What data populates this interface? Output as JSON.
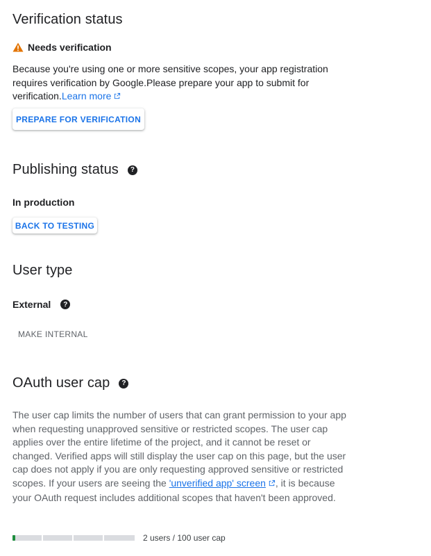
{
  "verification": {
    "title": "Verification status",
    "status": "Needs verification",
    "description": "Because you're using one or more sensitive scopes, your app registration requires verification by Google.Please prepare your app to submit for verification.",
    "learn_more": "Learn more",
    "button": "PREPARE FOR VERIFICATION"
  },
  "publishing": {
    "title": "Publishing status",
    "status": "In production",
    "button": "BACK TO TESTING"
  },
  "user_type": {
    "title": "User type",
    "value": "External",
    "button": "MAKE INTERNAL"
  },
  "cap": {
    "title": "OAuth user cap",
    "description_before": "The user cap limits the number of users that can grant permission to your app when requesting unapproved sensitive or restricted scopes. The user cap applies over the entire lifetime of the project, and it cannot be reset or changed. Verified apps will still display the user cap on this page, but the user cap does not apply if you are only requesting approved sensitive or restricted scopes. If your users are seeing the",
    "link": "'unverified app' screen",
    "description_after": ", it is because your OAuth request includes additional scopes that haven't been approved.",
    "usage_text": "2 users / 100 user cap",
    "used": 2,
    "limit": 100
  },
  "colors": {
    "accent": "#1a73e8",
    "warning": "#e37400",
    "progress": "#1e8e3e"
  }
}
